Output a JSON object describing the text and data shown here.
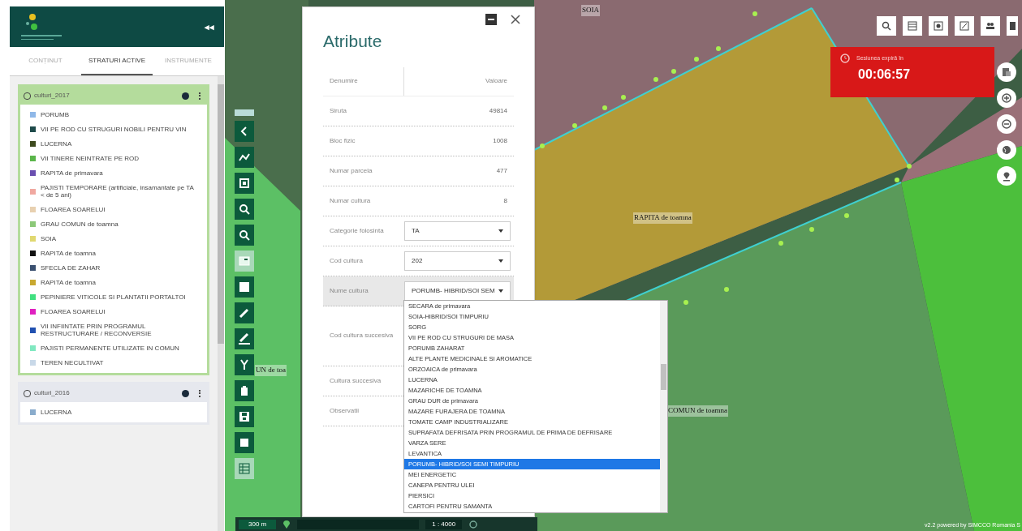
{
  "sidebar": {
    "collapse_glyph": "◂◂",
    "tabs": [
      {
        "label": "CONȚINUT",
        "selected": false
      },
      {
        "label": "STRATURI ACTIVE",
        "selected": true
      },
      {
        "label": "INSTRUMENTE",
        "selected": false
      }
    ],
    "layers": [
      {
        "name": "culturi_2017",
        "selected": true,
        "items": [
          {
            "label": "PORUMB",
            "color": "#8fb8e8"
          },
          {
            "label": "VII PE ROD CU STRUGURI NOBILI PENTRU VIN",
            "color": "#1e4a4a"
          },
          {
            "label": "LUCERNA",
            "color": "#3d4a1e"
          },
          {
            "label": "VII TINERE NEINTRATE PE ROD",
            "color": "#5ab54a"
          },
          {
            "label": "RAPITA de primavara",
            "color": "#6a4fb0"
          },
          {
            "label": "PAJISTI TEMPORARE (artificiale, insamantate pe TA < de 5 ani)",
            "color": "#f0a8a0"
          },
          {
            "label": "FLOAREA SOARELUI",
            "color": "#e8d0b0"
          },
          {
            "label": "GRAU COMUN de toamna",
            "color": "#8cc878"
          },
          {
            "label": "SOIA",
            "color": "#e0d870"
          },
          {
            "label": "RAPITA de toamna",
            "color": "#111111"
          },
          {
            "label": "SFECLA DE ZAHAR",
            "color": "#3a5070"
          },
          {
            "label": "RAPITA de toamna",
            "color": "#c8a830"
          },
          {
            "label": "PEPINIERE VITICOLE SI PLANTATII PORTALTOI",
            "color": "#40e080"
          },
          {
            "label": "FLOAREA SOARELUI",
            "color": "#e020c0"
          },
          {
            "label": "VII INFIINTATE PRIN PROGRAMUL RESTRUCTURARE / RECONVERSIE",
            "color": "#2050b0"
          },
          {
            "label": "PAJISTI PERMANENTE UTILIZATE IN COMUN",
            "color": "#80e8c0"
          },
          {
            "label": "TEREN NECULTIVAT",
            "color": "#c8d8e8"
          }
        ]
      },
      {
        "name": "culturi_2016",
        "selected": false,
        "items": [
          {
            "label": "LUCERNA",
            "color": "#8aaccc"
          }
        ]
      }
    ]
  },
  "dialog": {
    "title": "Atribute",
    "header": [
      "Denumire",
      "Valoare"
    ],
    "rows": [
      {
        "kind": "text",
        "label": "Siruta",
        "value": "49814",
        "highlighted": false
      },
      {
        "kind": "text",
        "label": "Bloc fizic",
        "value": "1008",
        "highlighted": false
      },
      {
        "kind": "text",
        "label": "Numar parcela",
        "value": "477",
        "highlighted": false
      },
      {
        "kind": "text",
        "label": "Numar cultura",
        "value": "8",
        "highlighted": false
      },
      {
        "kind": "select",
        "label": "Categorie folosinta",
        "value": "TA",
        "highlighted": false
      },
      {
        "kind": "select",
        "label": "Cod cultura",
        "value": "202",
        "highlighted": false
      },
      {
        "kind": "select",
        "label": "Nume cultura",
        "value": "PORUMB- HIBRID/SOI SEM",
        "highlighted": true
      },
      {
        "kind": "text",
        "label": "Cod cultura succesiva",
        "value": "",
        "highlighted": false
      },
      {
        "kind": "text",
        "label": "Cultura succesiva",
        "value": "",
        "highlighted": false
      },
      {
        "kind": "text",
        "label": "Observatii",
        "value": "",
        "highlighted": false
      }
    ]
  },
  "dropdown": {
    "options": [
      {
        "label": "SECARA de primavara",
        "selected": false
      },
      {
        "label": "SOIA-HIBRID/SOI TIMPURIU",
        "selected": false
      },
      {
        "label": "SORG",
        "selected": false
      },
      {
        "label": "VII PE ROD CU STRUGURI DE MASA",
        "selected": false
      },
      {
        "label": "PORUMB ZAHARAT",
        "selected": false
      },
      {
        "label": "ALTE PLANTE MEDICINALE SI AROMATICE",
        "selected": false
      },
      {
        "label": "ORZOAICA de primavara",
        "selected": false
      },
      {
        "label": "LUCERNA",
        "selected": false
      },
      {
        "label": "MAZARICHE DE TOAMNA",
        "selected": false
      },
      {
        "label": "GRAU DUR de primavara",
        "selected": false
      },
      {
        "label": "MAZARE FURAJERA DE TOAMNA",
        "selected": false
      },
      {
        "label": "TOMATE CAMP INDUSTRIALIZARE",
        "selected": false
      },
      {
        "label": "SUPRAFATA DEFRISATA PRIN PROGRAMUL DE PRIMA DE DEFRISARE",
        "selected": false
      },
      {
        "label": "VARZA SERE",
        "selected": false
      },
      {
        "label": "LEVANTICA",
        "selected": false
      },
      {
        "label": "PORUMB- HIBRID/SOI SEMI TIMPURIU",
        "selected": true
      },
      {
        "label": "MEI ENERGETIC",
        "selected": false
      },
      {
        "label": "CANEPA PENTRU ULEI",
        "selected": false
      },
      {
        "label": "PIERSICI",
        "selected": false
      },
      {
        "label": "CARTOFI PENTRU SAMANTA",
        "selected": false
      }
    ]
  },
  "session": {
    "label": "Sesiunea expiră în",
    "time": "00:06:57"
  },
  "map_labels": [
    "SOIA",
    "RAPITA de toamna",
    "COMUN de toamna",
    "UN de toa"
  ],
  "status_bar": {
    "scale": "300 m",
    "ratio": "1 : 4000"
  },
  "attribution": "v2.2 powered by SIMCCO Romania S"
}
